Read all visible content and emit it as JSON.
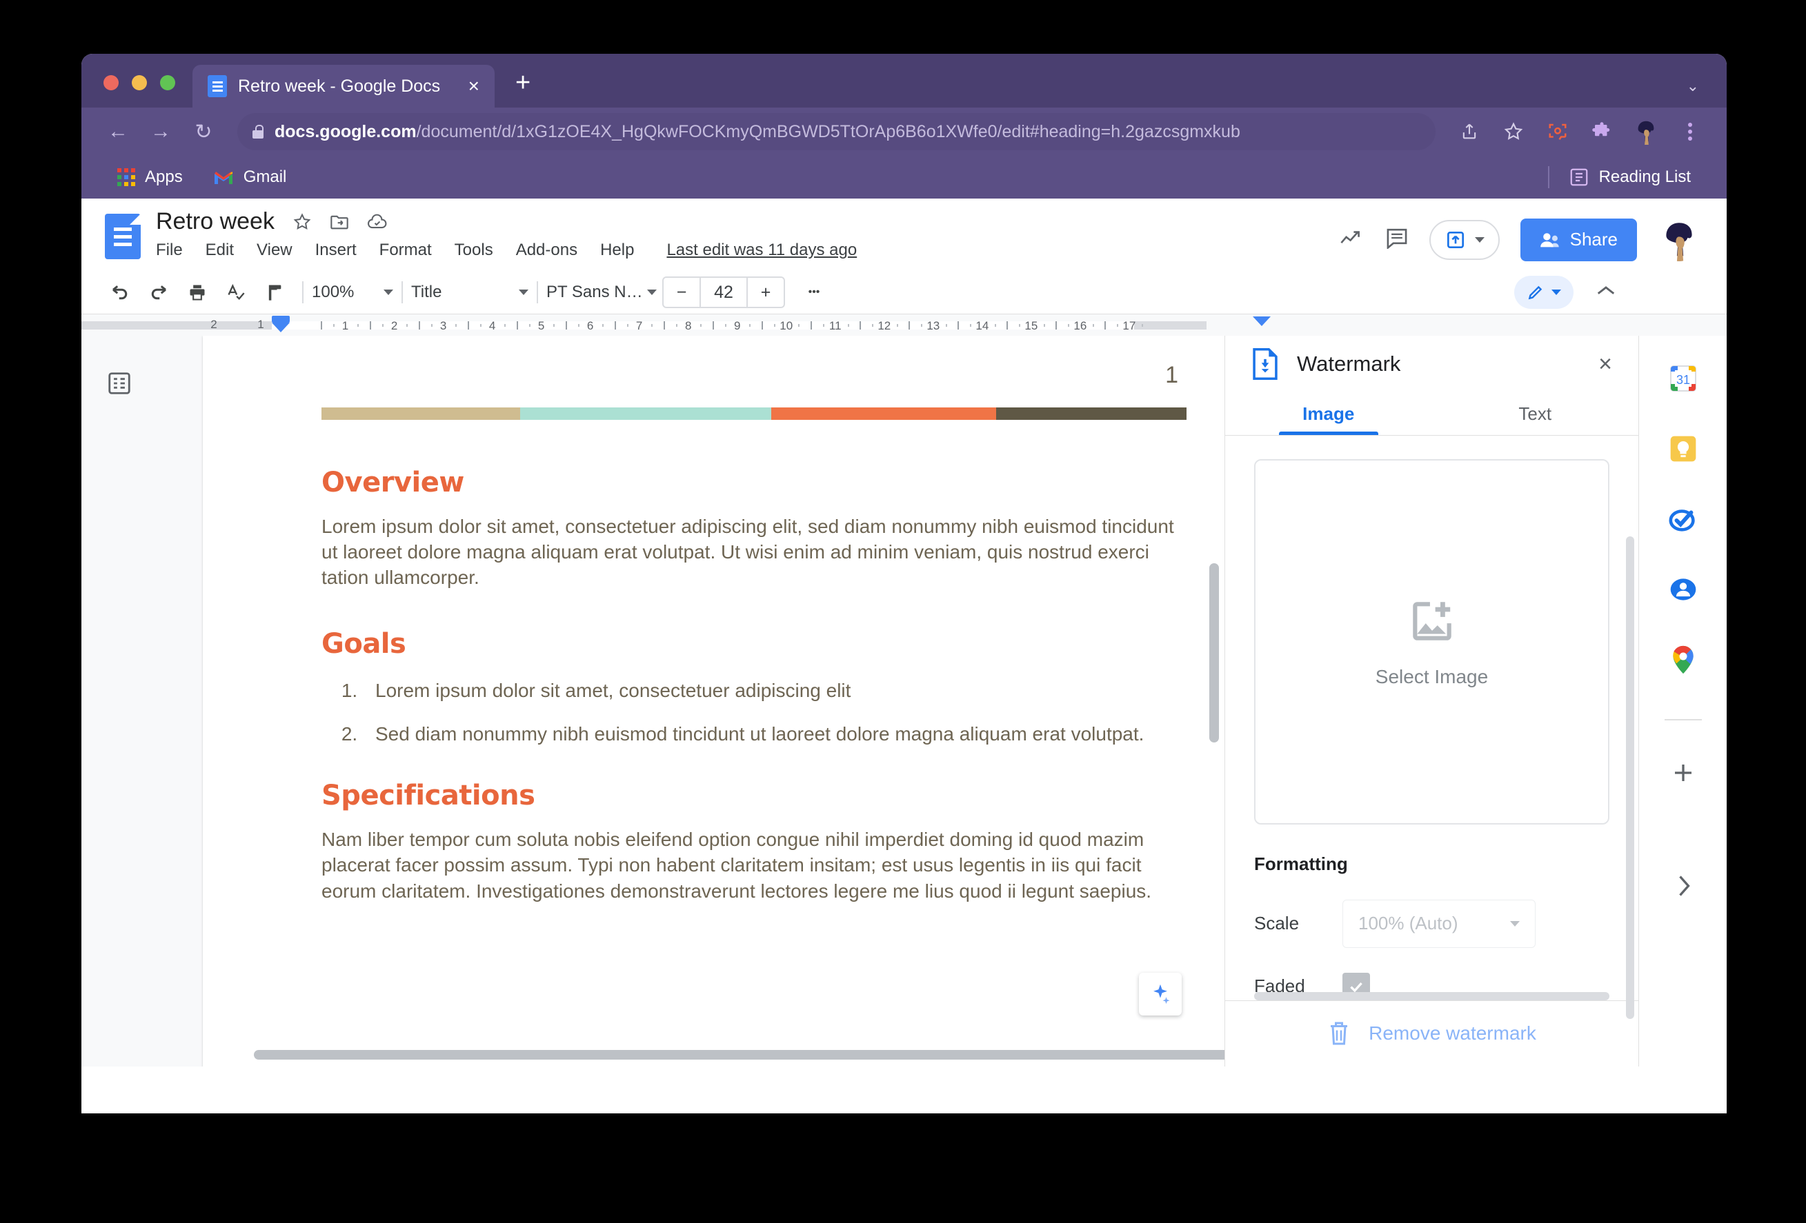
{
  "browser": {
    "tab": {
      "title": "Retro week - Google Docs",
      "favicon": "docs-icon",
      "close": "×"
    },
    "newtab_label": "+",
    "window_chevron": "⌄",
    "nav": {
      "back": "←",
      "forward": "→",
      "reload": "↻"
    },
    "url": {
      "domain": "docs.google.com",
      "path": "/document/d/1xG1zOE4X_HgQkwFOCKmyQmBGWD5TtOrAp6B6o1XWfe0/edit#heading=h.2gazcsgmxkub"
    },
    "omni_actions": [
      "share-icon",
      "star-icon",
      "screenshot-icon",
      "extensions-icon",
      "profile-avatar",
      "overflow-menu-icon"
    ],
    "bookmarks": [
      {
        "label": "Apps",
        "icon": "apps-grid-icon"
      },
      {
        "label": "Gmail",
        "icon": "gmail-icon"
      }
    ],
    "reading_list": {
      "label": "Reading List",
      "icon": "reading-list-icon"
    }
  },
  "docs": {
    "title": "Retro week",
    "title_icons": [
      "star-icon",
      "move-to-folder-icon",
      "cloud-saved-icon"
    ],
    "menus": [
      "File",
      "Edit",
      "View",
      "Insert",
      "Format",
      "Tools",
      "Add-ons",
      "Help"
    ],
    "last_edit": "Last edit was 11 days ago",
    "header_actions": {
      "trends_icon": "trending-up-icon",
      "comments_icon": "comment-icon",
      "present_icon": "present-upload-icon",
      "share_label": "Share"
    }
  },
  "toolbar": {
    "undo": "undo-icon",
    "redo": "redo-icon",
    "print": "print-icon",
    "spelling": "spellcheck-icon",
    "paint": "paint-format-icon",
    "zoom": "100%",
    "style": "Title",
    "font": "PT Sans N…",
    "font_decrease": "−",
    "font_size": "42",
    "font_increase": "+",
    "more": "•••",
    "mode": "editing-mode-pencil",
    "collapse": "collapse-toolbar-icon"
  },
  "ruler": {
    "left_numbers": [
      "2",
      "1"
    ],
    "right_numbers": [
      "1",
      "2",
      "3",
      "4",
      "5",
      "6",
      "7",
      "8",
      "9",
      "10",
      "11",
      "12",
      "13",
      "14",
      "15",
      "16",
      "17"
    ]
  },
  "document": {
    "page_number": "1",
    "color_bar": [
      "#cfbc90",
      "#abe0d3",
      "#f07446",
      "#5f5845"
    ],
    "sections": [
      {
        "heading": "Overview",
        "type": "paragraph",
        "text": "Lorem ipsum dolor sit amet, consectetuer adipiscing elit, sed diam nonummy nibh euismod tincidunt ut laoreet dolore magna aliquam erat volutpat. Ut wisi enim ad minim veniam, quis nostrud exerci tation ullamcorper."
      },
      {
        "heading": "Goals",
        "type": "list",
        "items": [
          "Lorem ipsum dolor sit amet, consectetuer adipiscing elit",
          "Sed diam nonummy nibh euismod tincidunt ut laoreet dolore magna aliquam erat volutpat."
        ]
      },
      {
        "heading": "Specifications",
        "type": "paragraph",
        "text": "Nam liber tempor cum soluta nobis eleifend option congue nihil imperdiet doming id quod mazim placerat facer possim assum. Typi non habent claritatem insitam; est usus legentis in iis qui facit eorum claritatem. Investigationes demonstraverunt lectores legere me lius quod ii legunt saepius."
      }
    ],
    "heading_color": "#e8663c",
    "body_color": "#6e6553",
    "outline_toggle": "document-outline-icon",
    "explore_button": "explore-icon"
  },
  "watermark_panel": {
    "title": "Watermark",
    "icon": "watermark-doc-icon",
    "close": "×",
    "tabs": [
      {
        "label": "Image",
        "active": true
      },
      {
        "label": "Text",
        "active": false
      }
    ],
    "dropzone": {
      "label": "Select Image",
      "icon": "add-image-icon"
    },
    "formatting_title": "Formatting",
    "scale": {
      "label": "Scale",
      "value": "100% (Auto)"
    },
    "faded": {
      "label": "Faded",
      "checked": true
    },
    "remove": {
      "label": "Remove watermark",
      "icon": "trash-icon"
    }
  },
  "app_rail": {
    "items": [
      "calendar-icon",
      "keep-icon",
      "tasks-icon",
      "contacts-icon",
      "maps-icon"
    ],
    "add": "+",
    "expand": "›"
  }
}
